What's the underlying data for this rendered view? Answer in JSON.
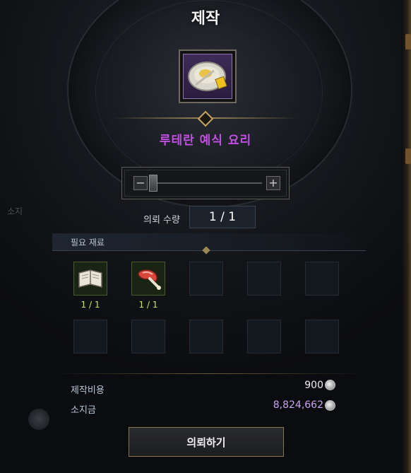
{
  "window": {
    "title": "제작"
  },
  "item": {
    "name": "루테란 예식 요리",
    "icon": "dish-icon"
  },
  "quantity_slider": {
    "minus_label": "−",
    "plus_label": "+",
    "value_fraction": 0.0
  },
  "request_quantity": {
    "label": "의뢰 수량",
    "value": "1 / 1"
  },
  "materials": {
    "title": "필요 재료",
    "slots": [
      {
        "icon": "book-icon",
        "count": "1 / 1"
      },
      {
        "icon": "meat-icon",
        "count": "1 / 1"
      },
      {
        "icon": "",
        "count": ""
      },
      {
        "icon": "",
        "count": ""
      },
      {
        "icon": "",
        "count": ""
      },
      {
        "icon": "",
        "count": ""
      },
      {
        "icon": "",
        "count": ""
      },
      {
        "icon": "",
        "count": ""
      },
      {
        "icon": "",
        "count": ""
      },
      {
        "icon": "",
        "count": ""
      }
    ]
  },
  "costs": {
    "craft_cost_label": "제작비용",
    "craft_cost_value": "900",
    "owned_label": "소지금",
    "owned_value": "8,824,662",
    "currency_icon": "silver-coin-icon"
  },
  "action": {
    "label": "의뢰하기"
  },
  "colors": {
    "item_name": "#c24ee6",
    "owned_value": "#c9a2f0",
    "material_count": "#c8e65a",
    "gold_accent": "#9c8756"
  },
  "background_ghost_text": "소지"
}
